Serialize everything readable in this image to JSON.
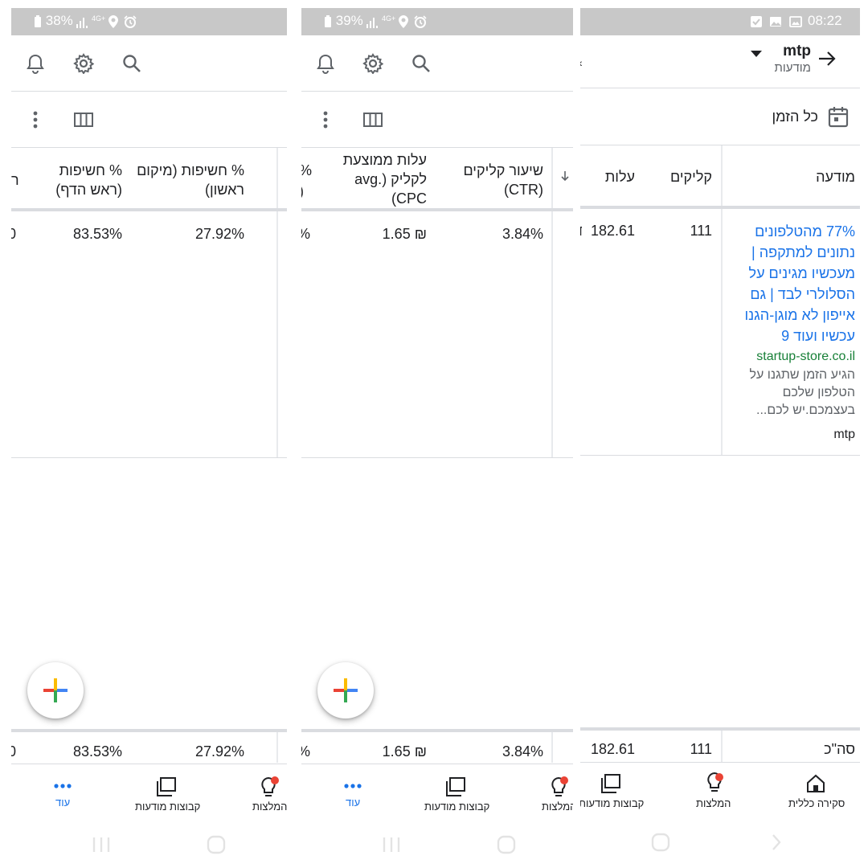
{
  "panels": {
    "left": {
      "status": {
        "battery": "38%"
      },
      "columns": [
        {
          "label": "% חשיפות (מיקום ראשון)",
          "value": "27.92%",
          "total": "27.92%"
        },
        {
          "label": "% חשיפות (ראש הדף)",
          "value": "83.53%",
          "total": "83.53%"
        }
      ],
      "edge": {
        "header": "ר",
        "value": "0",
        "total": "0"
      }
    },
    "middle": {
      "status": {
        "battery": "39%"
      },
      "columns": [
        {
          "label": "שיעור קליקים (CTR)",
          "value": "3.84%",
          "total": "3.84%"
        },
        {
          "label": "עלות ממוצעת לקליק (avg. CPC)",
          "value": "1.65 ₪",
          "total": "1.65 ₪"
        }
      ],
      "edge": {
        "header_line1": "%",
        "header_line2": "(",
        "value": "%",
        "total": "%"
      }
    },
    "right": {
      "status": {
        "time": "08:22"
      },
      "header": {
        "campaign": "mtp",
        "subtitle": "מודעות"
      },
      "date_range": "כל הזמן",
      "columns": {
        "ad": "מודעה",
        "clicks": "קליקים",
        "cost": "עלות"
      },
      "row": {
        "title": "77% מהטלפונים נתונים למתקפה | מעכשיו מגינים על הסלולרי לבד | גם אייפון לא מוגן-הגנו עכשיו ועוד 9",
        "url": "startup-store.co.il",
        "description": "הגיע הזמן שתגנו על הטלפון שלכם בעצמכם.יש לכם...",
        "ad_group": "mtp",
        "clicks": "111",
        "cost": "182.61"
      },
      "total_row": {
        "label": "סה\"כ",
        "clicks": "111",
        "cost": "182.61"
      }
    }
  },
  "bottom_nav": {
    "more": "עוד",
    "ad_groups": "קבוצות מודעות",
    "recommendations": "המלצות",
    "overview": "סקירה כללית"
  },
  "status_icons": {
    "signal": "4G+",
    "location": "location-icon",
    "alarm": "alarm-icon"
  },
  "colors": {
    "accent": "#1a73e8",
    "url_green": "#188038",
    "badge_red": "#ea4335",
    "statusbar": "#c8c8c8"
  }
}
